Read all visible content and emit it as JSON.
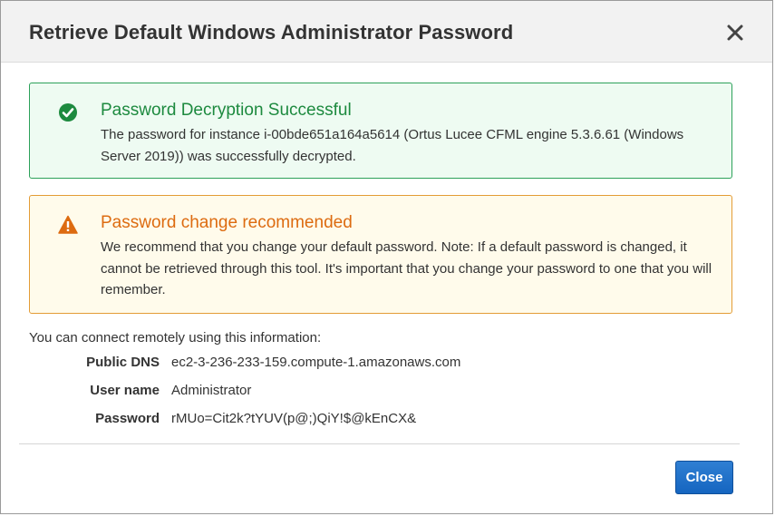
{
  "dialog": {
    "title": "Retrieve Default Windows Administrator Password",
    "close_icon": "close-icon"
  },
  "success_alert": {
    "icon": "check-circle-icon",
    "title": "Password Decryption Successful",
    "body": "The password for instance i-00bde651a164a5614 (Ortus Lucee CFML engine 5.3.6.61 (Windows Server 2019)) was successfully decrypted.",
    "color": "#1d8a3f"
  },
  "warning_alert": {
    "icon": "warning-triangle-icon",
    "title": "Password change recommended",
    "body": "We recommend that you change your default password. Note: If a default password is changed, it cannot be retrieved through this tool. It's important that you change your password to one that you will remember.",
    "color": "#dd6b10"
  },
  "connection": {
    "intro": "You can connect remotely using this information:",
    "rows": [
      {
        "label": "Public DNS",
        "value": "ec2-3-236-233-159.compute-1.amazonaws.com"
      },
      {
        "label": "User name",
        "value": "Administrator"
      },
      {
        "label": "Password",
        "value": "rMUo=Cit2k?tYUV(p@;)QiY!$@kEnCX&"
      }
    ]
  },
  "footer": {
    "close_label": "Close",
    "accent": "#1565c0"
  }
}
